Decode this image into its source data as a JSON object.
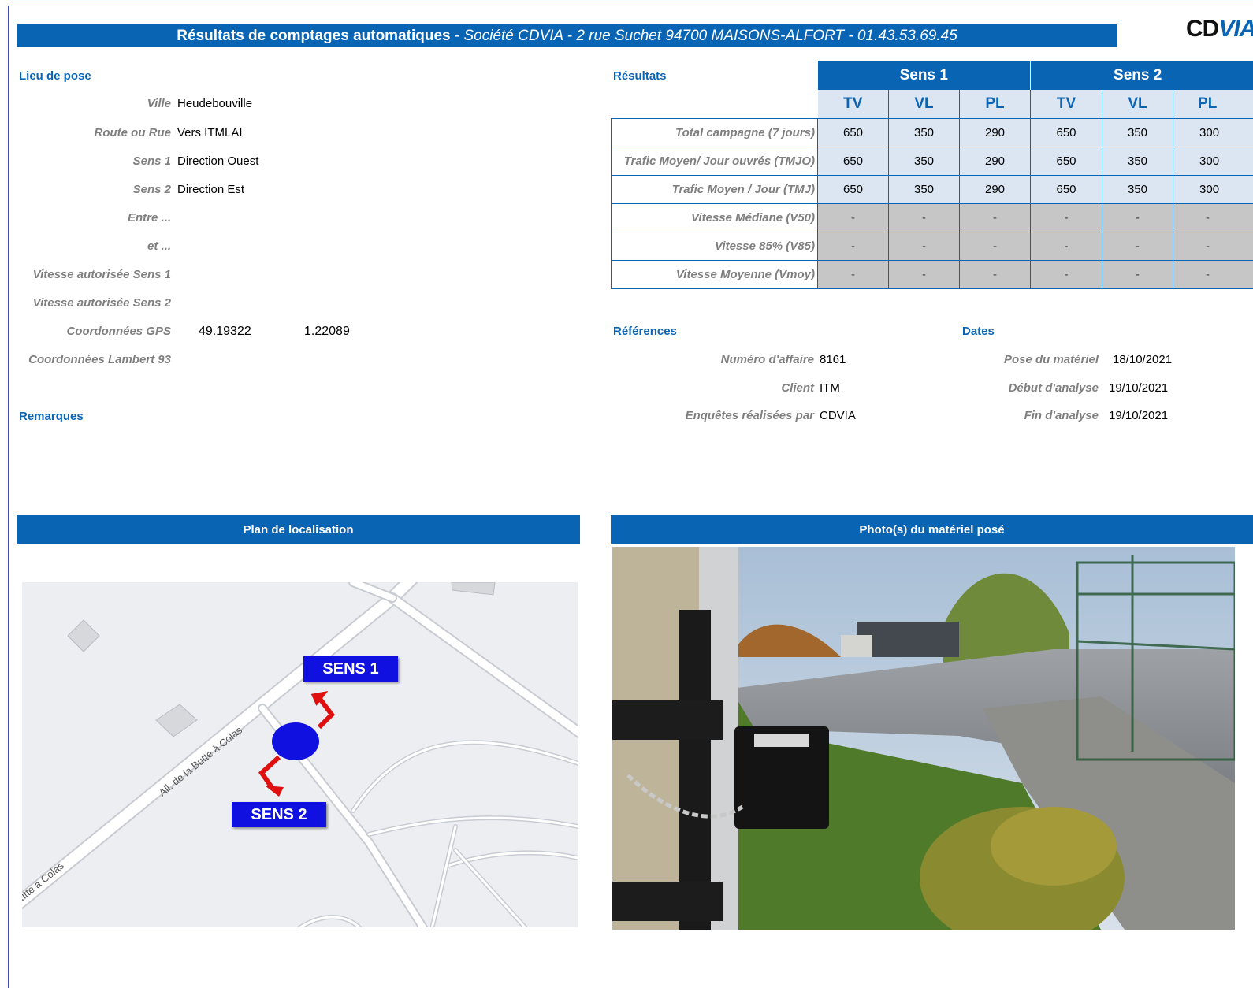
{
  "header": {
    "title_bold": "Résultats de comptages automatiques",
    "title_separator": " - ",
    "title_italic": "Société CDVIA - 2 rue Suchet 94700 MAISONS-ALFORT - 01.43.53.69.45",
    "logo_part1": "CD",
    "logo_part2": "VIA"
  },
  "lieu_de_pose": {
    "heading": "Lieu de pose",
    "fields": [
      {
        "label": "Ville",
        "value": "Heudebouville"
      },
      {
        "label": "Route ou Rue",
        "value": "Vers ITMLAI"
      },
      {
        "label": "Sens 1",
        "value": "Direction Ouest"
      },
      {
        "label": "Sens 2",
        "value": "Direction Est"
      },
      {
        "label": "Entre ...",
        "value": ""
      },
      {
        "label": "et ...",
        "value": ""
      },
      {
        "label": "Vitesse autorisée Sens 1",
        "value": ""
      },
      {
        "label": "Vitesse autorisée Sens 2",
        "value": ""
      },
      {
        "label": "Coordonnées GPS",
        "value": "49.19322",
        "value2": "1.22089"
      },
      {
        "label": "Coordonnées Lambert 93",
        "value": ""
      }
    ]
  },
  "remarques": {
    "heading": "Remarques"
  },
  "resultats": {
    "heading": "Résultats",
    "sens1": "Sens 1",
    "sens2": "Sens 2",
    "columns": [
      "TV",
      "VL",
      "PL",
      "TV",
      "VL",
      "PL"
    ],
    "rows": [
      {
        "label": "Total campagne (7 jours)",
        "values": [
          "650",
          "350",
          "290",
          "650",
          "350",
          "300"
        ]
      },
      {
        "label": "Trafic Moyen/ Jour ouvrés (TMJO)",
        "values": [
          "650",
          "350",
          "290",
          "650",
          "350",
          "300"
        ]
      },
      {
        "label": "Trafic Moyen / Jour (TMJ)",
        "values": [
          "650",
          "350",
          "290",
          "650",
          "350",
          "300"
        ]
      },
      {
        "label": "Vitesse Médiane (V50)",
        "values": [
          "-",
          "-",
          "-",
          "-",
          "-",
          "-"
        ]
      },
      {
        "label": "Vitesse 85% (V85)",
        "values": [
          "-",
          "-",
          "-",
          "-",
          "-",
          "-"
        ]
      },
      {
        "label": "Vitesse Moyenne (Vmoy)",
        "values": [
          "-",
          "-",
          "-",
          "-",
          "-",
          "-"
        ]
      }
    ]
  },
  "references": {
    "heading": "Références",
    "numero_label": "Numéro d'affaire",
    "numero_value": "8161",
    "client_label": "Client",
    "client_value": "ITM",
    "enquetes_label": "Enquêtes réalisées par",
    "enquetes_value": "CDVIA"
  },
  "dates": {
    "heading": "Dates",
    "pose_label": "Pose du matériel",
    "pose_value": "18/10/2021",
    "debut_label": "Début d'analyse",
    "debut_value": "19/10/2021",
    "fin_label": "Fin d'analyse",
    "fin_value": "19/10/2021"
  },
  "plan": {
    "title": "Plan de localisation",
    "sens1_label": "SENS 1",
    "sens2_label": "SENS 2",
    "road_label_1": "All. de la Butte à Colas",
    "road_label_2": "utte à Colas"
  },
  "photo": {
    "title": "Photo(s) du matériel posé"
  },
  "colors": {
    "accent": "#0a64b4",
    "light_cell": "#dce6f2",
    "gray_cell": "#c6c6c6",
    "marker": "#1010e0",
    "arrow": "#e01010"
  }
}
